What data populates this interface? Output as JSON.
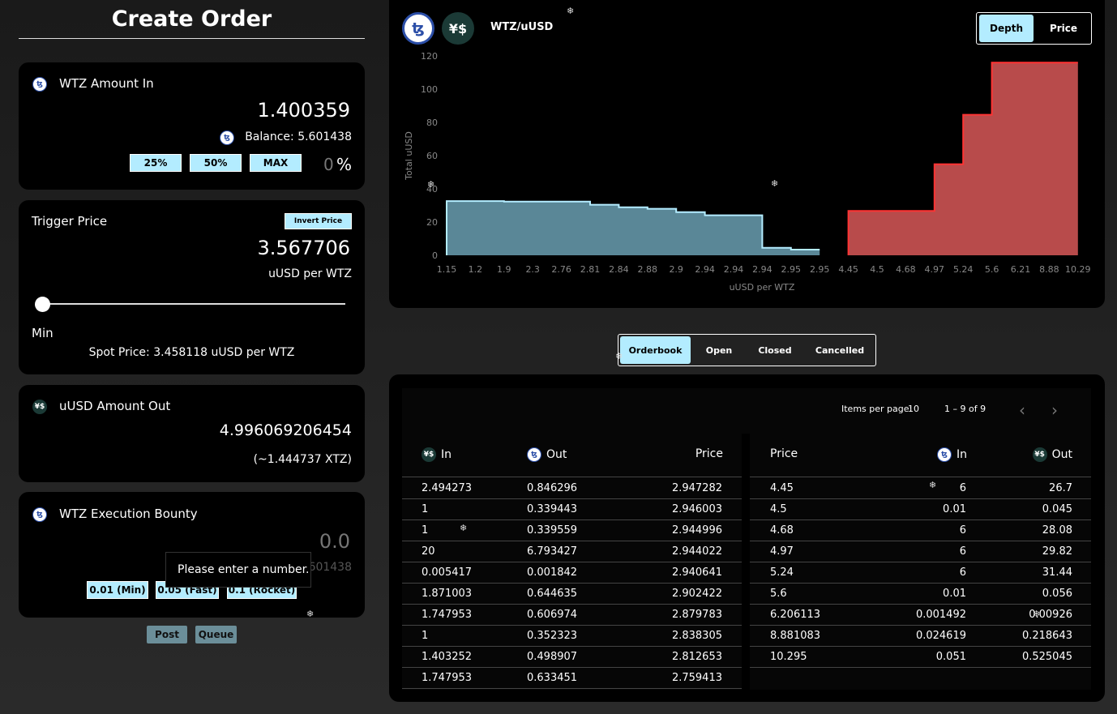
{
  "page_title": "Create Order",
  "amount_in": {
    "label": "WTZ Amount In",
    "value": "1.400359",
    "balance": "Balance: 5.601438",
    "pct_buttons": [
      "25%",
      "50%",
      "MAX"
    ],
    "pct_value": "0",
    "pct_sign": "%"
  },
  "trigger": {
    "label": "Trigger Price",
    "invert_label": "Invert Price",
    "value": "3.567706",
    "unit": "uUSD per WTZ",
    "slider_label": "Min",
    "slider_level": 0,
    "spot": "Spot Price: 3.458118 uUSD per WTZ"
  },
  "amount_out": {
    "label": "uUSD Amount Out",
    "value": "4.996069206454",
    "xtz": "(~1.444737 XTZ)"
  },
  "bounty": {
    "label": "WTZ Execution Bounty",
    "placeholder": "0.0",
    "balance": "Balance: 5.601438",
    "tooltip": "Please enter a number.",
    "buttons": [
      "0.01 (Min)",
      "0.05 (Fast)",
      "0.1 (Rocket)"
    ]
  },
  "actions": {
    "post": "Post",
    "queue": "Queue"
  },
  "pair": {
    "label": "WTZ/uUSD",
    "toggle": [
      "Depth",
      "Price"
    ],
    "active": "Depth"
  },
  "icons": {
    "tez": "tez-icon",
    "usd": "uusd-icon"
  },
  "colors": {
    "bid": "#5a8797",
    "bid_line": "#b3ecff",
    "ask": "#b84b4b",
    "ask_line": "#ff3333",
    "accent": "#b3ecff"
  },
  "chart_data": {
    "type": "area",
    "xlabel": "uUSD per WTZ",
    "ylabel": "Total uUSD",
    "ylim": [
      0,
      120
    ],
    "y_ticks": [
      0,
      20,
      40,
      60,
      80,
      100,
      120
    ],
    "x_ticks": [
      "1.15",
      "1.2",
      "1.9",
      "2.3",
      "2.76",
      "2.81",
      "2.84",
      "2.88",
      "2.9",
      "2.94",
      "2.94",
      "2.94",
      "2.95",
      "2.95",
      "4.45",
      "4.5",
      "4.68",
      "4.97",
      "5.24",
      "5.6",
      "6.21",
      "8.88",
      "10.29"
    ],
    "series": [
      {
        "side": "bid",
        "values": [
          32.6,
          32.6,
          32.3,
          32.3,
          32.3,
          30.4,
          28.9,
          28.0,
          26.0,
          24.1,
          24.1,
          4.5,
          3.4,
          3.4
        ]
      },
      {
        "side": "ask",
        "values": [
          26.7,
          26.7,
          26.7,
          54.8,
          84.6,
          116.0,
          116.0,
          116.0,
          116.0
        ]
      }
    ]
  },
  "orders": {
    "tabs": [
      "Orderbook",
      "Open",
      "Closed",
      "Cancelled"
    ],
    "active_tab": "Orderbook",
    "items_per_page_label": "Items per page:",
    "items_per_page": "10",
    "range": "1 – 9 of 9",
    "bids_headers": [
      "In",
      "Out",
      "Price"
    ],
    "asks_headers": [
      "Price",
      "In",
      "Out"
    ],
    "bids": [
      [
        "2.494273",
        "0.846296",
        "2.947282"
      ],
      [
        "1",
        "0.339443",
        "2.946003"
      ],
      [
        "1",
        "0.339559",
        "2.944996"
      ],
      [
        "20",
        "6.793427",
        "2.944022"
      ],
      [
        "0.005417",
        "0.001842",
        "2.940641"
      ],
      [
        "1.871003",
        "0.644635",
        "2.902422"
      ],
      [
        "1.747953",
        "0.606974",
        "2.879783"
      ],
      [
        "1",
        "0.352323",
        "2.838305"
      ],
      [
        "1.403252",
        "0.498907",
        "2.812653"
      ],
      [
        "1.747953",
        "0.633451",
        "2.759413"
      ]
    ],
    "asks": [
      [
        "4.45",
        "6",
        "26.7"
      ],
      [
        "4.5",
        "0.01",
        "0.045"
      ],
      [
        "4.68",
        "6",
        "28.08"
      ],
      [
        "4.97",
        "6",
        "29.82"
      ],
      [
        "5.24",
        "6",
        "31.44"
      ],
      [
        "5.6",
        "0.01",
        "0.056"
      ],
      [
        "6.206113",
        "0.001492",
        "0.00926"
      ],
      [
        "8.881083",
        "0.024619",
        "0.218643"
      ],
      [
        "10.295",
        "0.051",
        "0.525045"
      ]
    ]
  }
}
